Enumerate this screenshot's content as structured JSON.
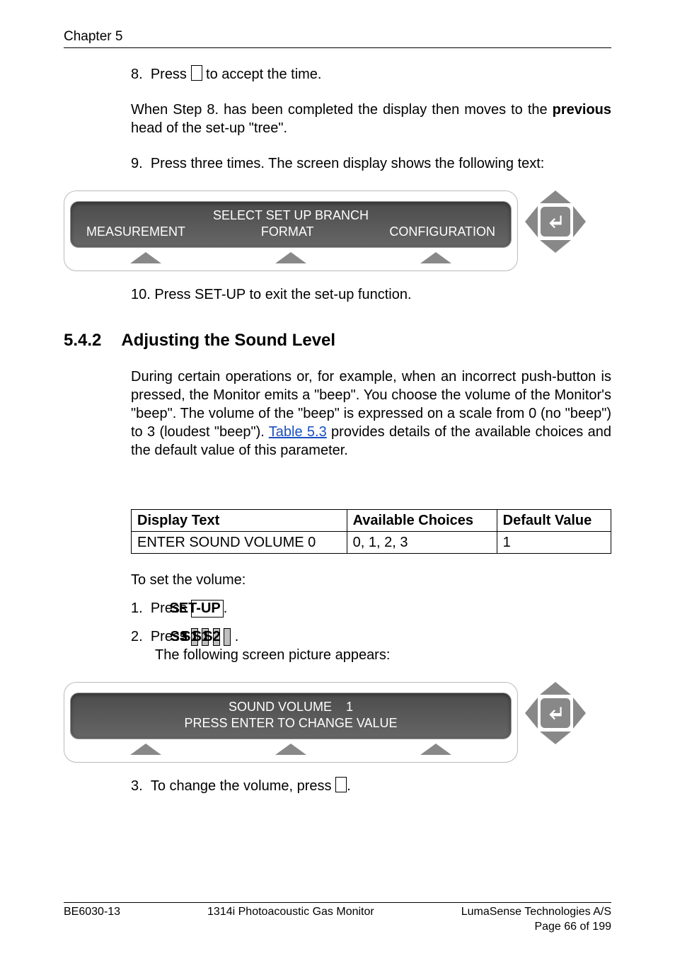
{
  "chapter": "Chapter 5",
  "steps": {
    "s8": {
      "num": "8.",
      "before": "Press ",
      "after": " to accept the time."
    },
    "after8": "When Step 8. has been completed the display then moves to the previous head of the set-up \"tree\".",
    "after8_bold": "previous",
    "s9": {
      "num": "9.",
      "text": "Press     three times. The screen display shows the following text:"
    },
    "s10": "10. Press SET-UP to exit the set-up function."
  },
  "lcd1": {
    "line1": "SELECT SET UP BRANCH",
    "cols": [
      "MEASUREMENT",
      "FORMAT",
      "CONFIGURATION"
    ]
  },
  "section": {
    "num": "5.4.2",
    "title": "Adjusting the Sound Level"
  },
  "para1_a": "During certain operations or, for example, when an incorrect push-button is pressed, the Monitor emits a \"beep\". You choose the volume of the Monitor's \"beep\". The volume of the \"beep\" is expressed on a scale from 0 (no \"beep\") to 3 (loudest \"beep\"). ",
  "para1_link": "Table 5.3",
  "para1_b": " provides details of the available choices and the default value of this parameter.",
  "table": {
    "h1": "Display Text",
    "h2": "Available Choices",
    "h3": "Default Value",
    "r1c1": "ENTER SOUND VOLUME 0",
    "r1c2": "0, 1, 2, 3",
    "r1c3": "1"
  },
  "toset": "To set the volume:",
  "step1": {
    "num": "1.",
    "text": "Press ",
    "btn": "SET-UP",
    "after": "."
  },
  "step2": {
    "num": "2.",
    "text": "Press  ",
    "b1": "S3",
    "b2": "S1",
    "b3": "S1",
    "b4": "S2",
    "after": " .",
    "line2": "The following screen picture appears:"
  },
  "lcd2": {
    "line1": "SOUND VOLUME    1",
    "line2": "PRESS ENTER TO CHANGE VALUE"
  },
  "step3": {
    "num": "3.",
    "before": "To change the volume, press ",
    "after": "."
  },
  "footer": {
    "left": "BE6030-13",
    "center": "1314i Photoacoustic Gas Monitor",
    "right1": "LumaSense Technologies A/S",
    "right2": "Page 66 of 199"
  }
}
